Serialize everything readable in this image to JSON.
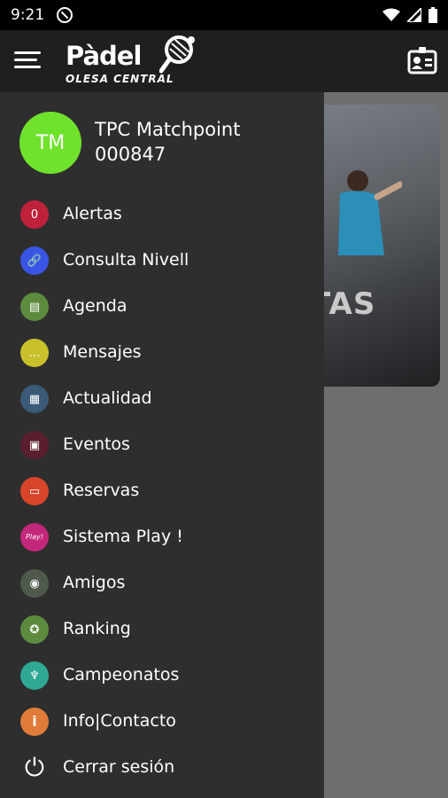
{
  "status_bar": {
    "time": "9:21",
    "icons": [
      "do-not-disturb-icon",
      "wifi-icon",
      "signal-icon",
      "battery-icon"
    ]
  },
  "app_bar": {
    "logo_text": "Pàdel",
    "logo_subtitle": "OLESA CENTRAL",
    "menu_icon": "hamburger-icon",
    "action_icon": "id-card-icon"
  },
  "background": {
    "banner_text": "TAS"
  },
  "profile": {
    "initials": "TM",
    "name": "TPC Matchpoint",
    "code": "000847",
    "avatar_color": "#6fe22c"
  },
  "menu": {
    "items": [
      {
        "label": "Alertas",
        "icon": "alert-icon",
        "color": "#c0213a",
        "glyph": "0"
      },
      {
        "label": "Consulta Nivell",
        "icon": "link-icon",
        "color": "#3a55e6",
        "glyph": "🔗"
      },
      {
        "label": "Agenda",
        "icon": "calendar-icon",
        "color": "#5e8a3e",
        "glyph": "▤"
      },
      {
        "label": "Mensajes",
        "icon": "chat-icon",
        "color": "#c9c12c",
        "glyph": "…"
      },
      {
        "label": "Actualidad",
        "icon": "news-icon",
        "color": "#3a5a78",
        "glyph": "▦"
      },
      {
        "label": "Eventos",
        "icon": "event-icon",
        "color": "#5a1f2e",
        "glyph": "▣"
      },
      {
        "label": "Reservas",
        "icon": "court-icon",
        "color": "#d8452a",
        "glyph": "▭"
      },
      {
        "label": "Sistema Play !",
        "icon": "play-icon",
        "color": "#c2277a",
        "glyph": "Play!"
      },
      {
        "label": "Amigos",
        "icon": "friends-icon",
        "color": "#4f5a4c",
        "glyph": "◉"
      },
      {
        "label": "Ranking",
        "icon": "medal-icon",
        "color": "#5e8a3e",
        "glyph": "✪"
      },
      {
        "label": "Campeonatos",
        "icon": "trophy-icon",
        "color": "#2fa894",
        "glyph": "♆"
      },
      {
        "label": "Info|Contacto",
        "icon": "info-icon",
        "color": "#e07b3a",
        "glyph": "i"
      },
      {
        "label": "Cerrar sesión",
        "icon": "power-icon",
        "color": "#2e2e2e",
        "glyph": "⏻"
      }
    ]
  }
}
